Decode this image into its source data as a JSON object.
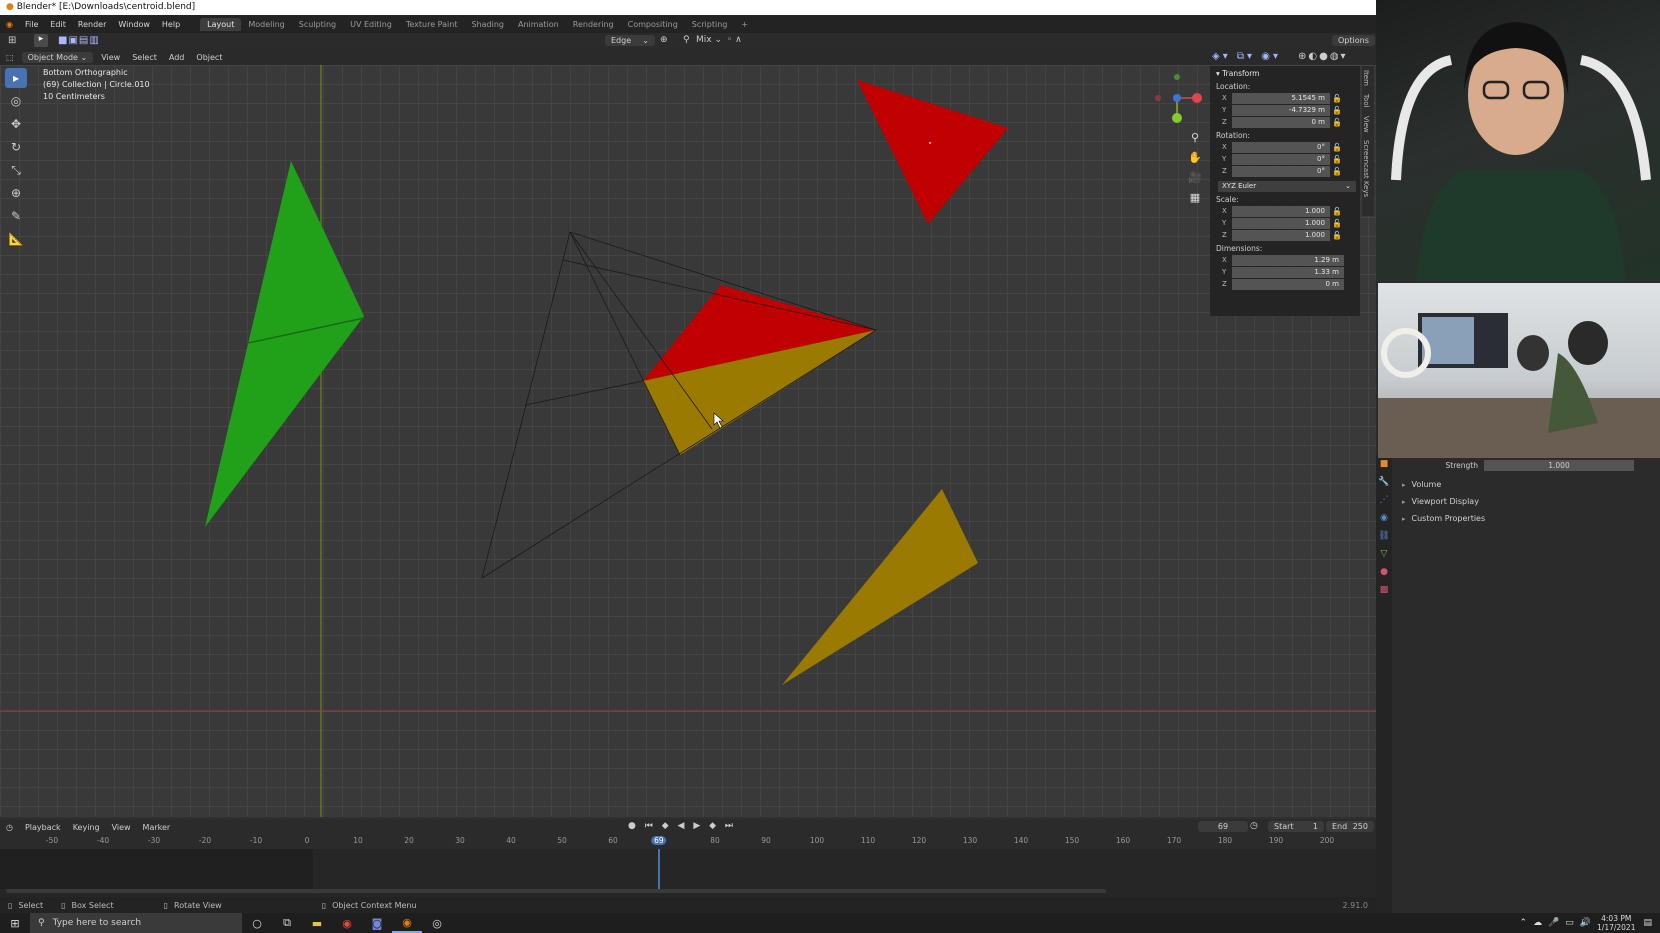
{
  "window": {
    "title": "Blender* [E:\\Downloads\\centroid.blend]"
  },
  "menubar": {
    "items": [
      "File",
      "Edit",
      "Render",
      "Window",
      "Help"
    ],
    "workspaces": [
      "Layout",
      "Modeling",
      "Sculpting",
      "UV Editing",
      "Texture Paint",
      "Shading",
      "Animation",
      "Rendering",
      "Compositing",
      "Scripting"
    ],
    "active_workspace": "Layout",
    "add_tab": "+"
  },
  "tool_header": {
    "snap_target": "Edge",
    "mix_mode": "Mix",
    "options_label": "Options"
  },
  "view_header": {
    "mode": "Object Mode",
    "menus": [
      "View",
      "Select",
      "Add",
      "Object"
    ]
  },
  "viewport": {
    "view_name": "Bottom Orthographic",
    "collection": "(69) Collection | Circle.010",
    "scale": "10 Centimeters",
    "colors": {
      "red": "#c00000",
      "green": "#21a11a",
      "yellow": "#9a7a00",
      "x_axis": "#b03838",
      "y_axis": "#7e8f16"
    }
  },
  "npanel": {
    "title": "Transform",
    "location_label": "Location:",
    "location": {
      "x": "5.1545 m",
      "y": "-4.7329 m",
      "z": "0 m"
    },
    "rotation_label": "Rotation:",
    "rotation": {
      "x": "0°",
      "y": "0°",
      "z": "0°"
    },
    "rotation_mode": "XYZ Euler",
    "scale_label": "Scale:",
    "scale": {
      "x": "1.000",
      "y": "1.000",
      "z": "1.000"
    },
    "dimensions_label": "Dimensions:",
    "dimensions": {
      "x": "1.29 m",
      "y": "1.33 m",
      "z": "0 m"
    },
    "axis_labels": {
      "x": "X",
      "y": "Y",
      "z": "Z"
    },
    "side_tabs": [
      "Item",
      "Tool",
      "View",
      "Screencast Keys"
    ]
  },
  "timeline": {
    "menus": [
      "Playback",
      "Keying",
      "View",
      "Marker"
    ],
    "current_frame": "69",
    "start_label": "Start",
    "start": "1",
    "end_label": "End",
    "end": "250",
    "ticks": [
      "-50",
      "-40",
      "-30",
      "-20",
      "-10",
      "0",
      "10",
      "20",
      "30",
      "40",
      "50",
      "60",
      "69",
      "80",
      "90",
      "100",
      "110",
      "120",
      "130",
      "140",
      "150",
      "160",
      "170",
      "180",
      "190",
      "200"
    ],
    "playhead_frame": 69
  },
  "statusbar": {
    "items": [
      "Select",
      "Box Select",
      "Rotate View",
      "Object Context Menu"
    ],
    "version": "2.91.0"
  },
  "properties": {
    "strength_label": "Strength",
    "strength_value": "1.000",
    "sections": [
      "Volume",
      "Viewport Display",
      "Custom Properties"
    ]
  },
  "taskbar": {
    "search_placeholder": "Type here to search",
    "time": "4:03 PM",
    "date": "1/17/2021"
  }
}
